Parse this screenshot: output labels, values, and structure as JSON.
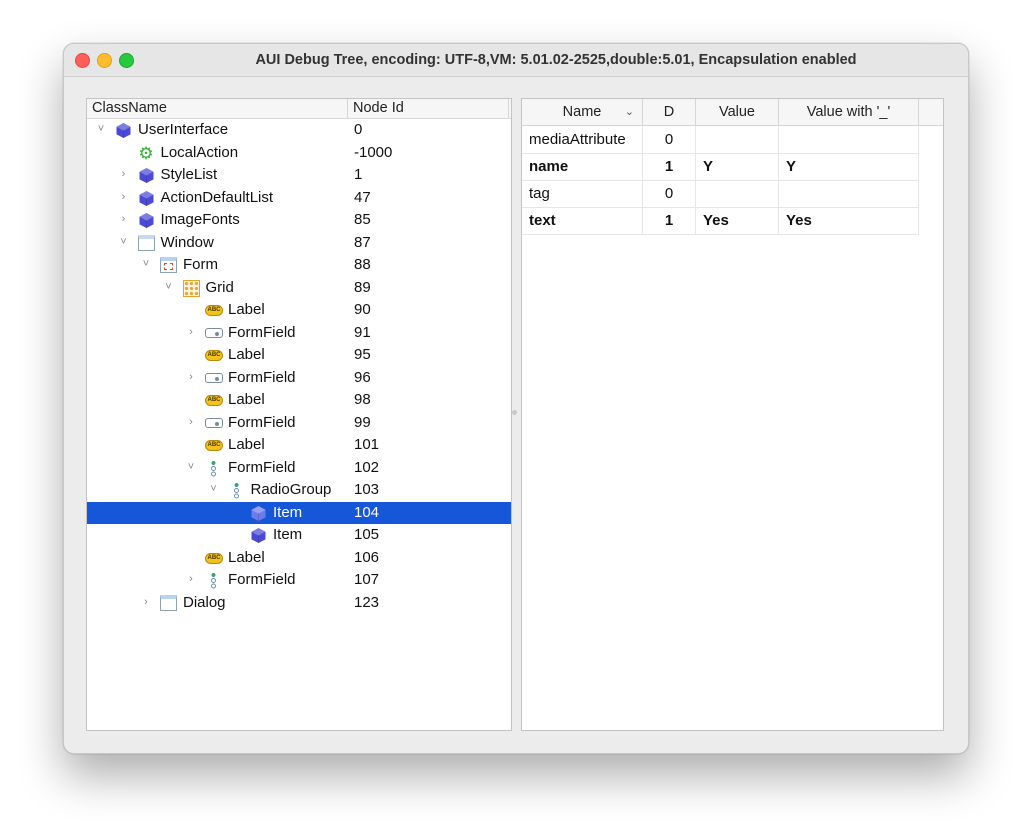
{
  "window": {
    "title": "AUI Debug Tree, encoding: UTF-8,VM: 5.01.02-2525,double:5.01, Encapsulation enabled"
  },
  "tree": {
    "columns": {
      "classname": "ClassName",
      "node_id": "Node Id"
    },
    "rows": [
      {
        "label": "UserInterface",
        "id": "0",
        "depth": 0,
        "expander": "expanded",
        "icon": "cube-icon"
      },
      {
        "label": "LocalAction",
        "id": "-1000",
        "depth": 1,
        "expander": "none",
        "icon": "gear-icon"
      },
      {
        "label": "StyleList",
        "id": "1",
        "depth": 1,
        "expander": "collapsed",
        "icon": "cube-icon"
      },
      {
        "label": "ActionDefaultList",
        "id": "47",
        "depth": 1,
        "expander": "collapsed",
        "icon": "cube-icon"
      },
      {
        "label": "ImageFonts",
        "id": "85",
        "depth": 1,
        "expander": "collapsed",
        "icon": "cube-icon"
      },
      {
        "label": "Window",
        "id": "87",
        "depth": 1,
        "expander": "expanded",
        "icon": "window-icon"
      },
      {
        "label": "Form",
        "id": "88",
        "depth": 2,
        "expander": "expanded",
        "icon": "form-icon"
      },
      {
        "label": "Grid",
        "id": "89",
        "depth": 3,
        "expander": "expanded",
        "icon": "grid-icon"
      },
      {
        "label": "Label",
        "id": "90",
        "depth": 4,
        "expander": "none",
        "icon": "label-icon"
      },
      {
        "label": "FormField",
        "id": "91",
        "depth": 4,
        "expander": "collapsed",
        "icon": "formfield-icon"
      },
      {
        "label": "Label",
        "id": "95",
        "depth": 4,
        "expander": "none",
        "icon": "label-icon"
      },
      {
        "label": "FormField",
        "id": "96",
        "depth": 4,
        "expander": "collapsed",
        "icon": "formfield-icon"
      },
      {
        "label": "Label",
        "id": "98",
        "depth": 4,
        "expander": "none",
        "icon": "label-icon"
      },
      {
        "label": "FormField",
        "id": "99",
        "depth": 4,
        "expander": "collapsed",
        "icon": "formfield-icon"
      },
      {
        "label": "Label",
        "id": "101",
        "depth": 4,
        "expander": "none",
        "icon": "label-icon"
      },
      {
        "label": "FormField",
        "id": "102",
        "depth": 4,
        "expander": "expanded",
        "icon": "radiogroup-icon"
      },
      {
        "label": "RadioGroup",
        "id": "103",
        "depth": 5,
        "expander": "expanded",
        "icon": "radiogroup-icon"
      },
      {
        "label": "Item",
        "id": "104",
        "depth": 6,
        "expander": "none",
        "icon": "cube-icon",
        "selected": true
      },
      {
        "label": "Item",
        "id": "105",
        "depth": 6,
        "expander": "none",
        "icon": "cube-icon"
      },
      {
        "label": "Label",
        "id": "106",
        "depth": 4,
        "expander": "none",
        "icon": "label-icon"
      },
      {
        "label": "FormField",
        "id": "107",
        "depth": 4,
        "expander": "collapsed",
        "icon": "radiogroup-icon"
      },
      {
        "label": "Dialog",
        "id": "123",
        "depth": 2,
        "expander": "collapsed",
        "icon": "dialog-icon"
      }
    ]
  },
  "attributes": {
    "columns": {
      "name": "Name",
      "d": "D",
      "value": "Value",
      "value_us": "Value with '_'"
    },
    "rows": [
      {
        "name": "mediaAttribute",
        "d": "0",
        "value": "",
        "value_us": "",
        "bold": false
      },
      {
        "name": "name",
        "d": "1",
        "value": "Y",
        "value_us": "Y",
        "bold": true
      },
      {
        "name": "tag",
        "d": "0",
        "value": "",
        "value_us": "",
        "bold": false
      },
      {
        "name": "text",
        "d": "1",
        "value": "Yes",
        "value_us": "Yes",
        "bold": true
      }
    ]
  },
  "colors": {
    "selection": "#1656d9",
    "cube": "#4a4ad6"
  }
}
